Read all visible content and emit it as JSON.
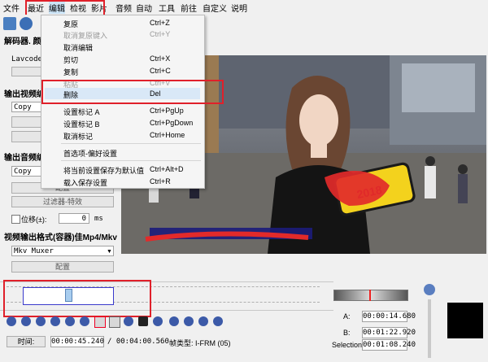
{
  "menubar": {
    "items": [
      "文件",
      "最近",
      "编辑",
      "检视",
      "影片",
      "音频",
      "自动",
      "工具",
      "前往",
      "自定义",
      "说明"
    ]
  },
  "left_panel": {
    "video_decoder_header": "解码器. 颜色",
    "lavcodec_label": "Lavcodec",
    "video_output_header": "输出视频编码",
    "video_copy": "Copy",
    "audio_output_header": "输出音频编码",
    "audio_copy": "Copy",
    "audio_btn_label": "配置",
    "filters_label": "过滤器-特效",
    "shift_label": "位移(±):",
    "shift_value": "0",
    "shift_unit": "ms",
    "output_format_header": "视频输出格式(容器)佳Mp4/Mkv",
    "muxer_value": "Mkv Muxer",
    "config_button": "配置"
  },
  "edit_menu": {
    "items": [
      {
        "label": "复原",
        "shortcut": "Ctrl+Z",
        "disabled": false
      },
      {
        "label": "取消复原键入",
        "shortcut": "Ctrl+Y",
        "disabled": true
      },
      {
        "label": "取消编辑",
        "shortcut": "",
        "disabled": false
      },
      {
        "label": "剪切",
        "shortcut": "Ctrl+X",
        "disabled": false
      },
      {
        "label": "复制",
        "shortcut": "Ctrl+C",
        "disabled": false
      },
      {
        "label": "粘贴",
        "shortcut": "Ctrl+V",
        "disabled": true
      },
      {
        "label": "删除",
        "shortcut": "Del",
        "disabled": false
      },
      {
        "label": "设置标记 A",
        "shortcut": "Ctrl+PgUp",
        "disabled": false
      },
      {
        "label": "设置标记 B",
        "shortcut": "Ctrl+PgDown",
        "disabled": false
      },
      {
        "label": "取消标记",
        "shortcut": "Ctrl+Home",
        "disabled": false
      },
      {
        "label": "首选项-偏好设置",
        "shortcut": "",
        "disabled": false
      },
      {
        "label": "将当前设置保存为默认值",
        "shortcut": "Ctrl+Alt+D",
        "disabled": false
      },
      {
        "label": "载入保存设置",
        "shortcut": "Ctrl+R",
        "disabled": false
      }
    ]
  },
  "video": {
    "sign_text": "2018"
  },
  "status": {
    "time_label": "时间:",
    "current_time": "00:00:45.240",
    "total_time": "/ 00:04:00.560",
    "frame_type": "帧类型: I-FRM (05)",
    "marker_a_label": "A:",
    "marker_a": "00:00:14.680",
    "marker_b_label": "B:",
    "marker_b": "00:01:22.920",
    "selection_label": "Selection:",
    "selection": "00:01:08.240"
  },
  "colors": {
    "highlight": "#e0202a",
    "accent": "#3c5aa8"
  }
}
